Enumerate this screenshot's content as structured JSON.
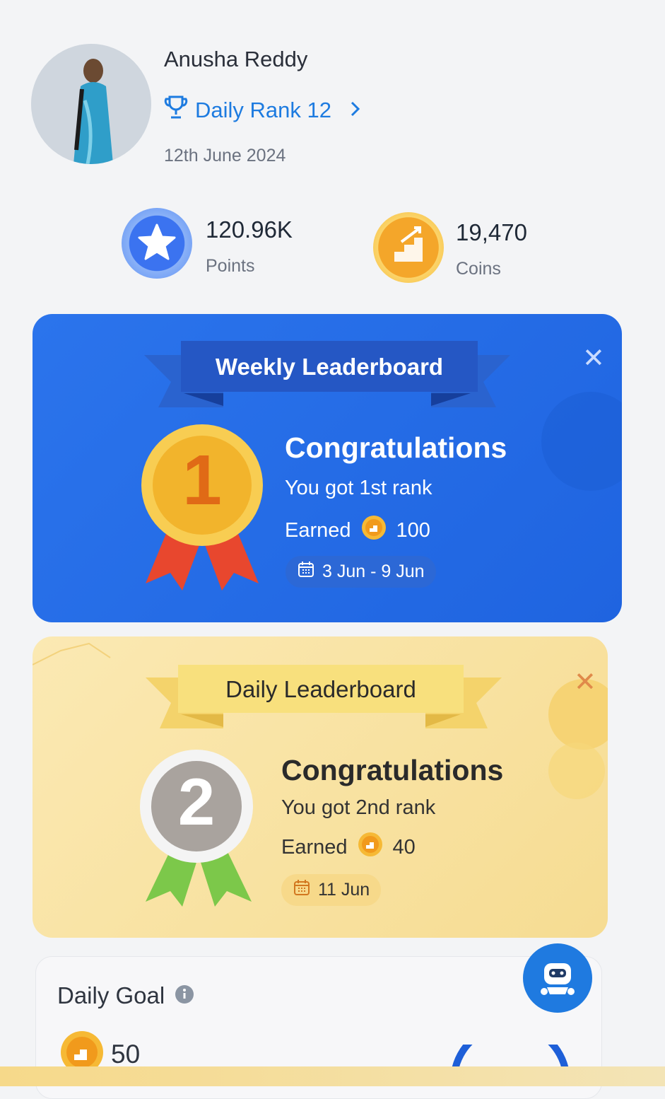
{
  "profile": {
    "name": "Anusha Reddy",
    "rank_label": "Daily Rank 12",
    "date": "12th June 2024"
  },
  "stats": {
    "points_value": "120.96K",
    "points_label": "Points",
    "coins_value": "19,470",
    "coins_label": "Coins"
  },
  "weekly": {
    "title": "Weekly Leaderboard",
    "rank_number": "1",
    "congrats": "Congratulations",
    "message": "You got 1st rank",
    "earned_label": "Earned",
    "earned_amount": "100",
    "date_range": "3 Jun - 9 Jun"
  },
  "daily": {
    "title": "Daily Leaderboard",
    "rank_number": "2",
    "congrats": "Congratulations",
    "message": "You got 2nd rank",
    "earned_label": "Earned",
    "earned_amount": "40",
    "date_range": "11 Jun"
  },
  "goal": {
    "title": "Daily Goal",
    "amount": "50"
  },
  "colors": {
    "accent_blue": "#1f6fe5",
    "coin_orange": "#f4a62a",
    "link_blue": "#1d7be0"
  }
}
